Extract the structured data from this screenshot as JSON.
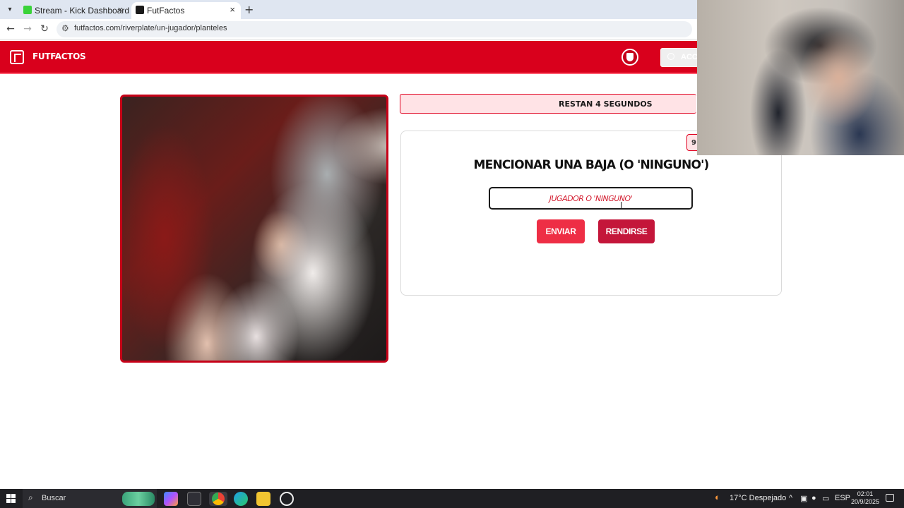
{
  "browser": {
    "tabs": [
      {
        "title": "Stream - Kick Dashboard",
        "close": "×"
      },
      {
        "title": "FutFactos",
        "close": "×"
      }
    ],
    "new_tab": "+",
    "url": "futfactos.com/riverplate/un-jugador/planteles"
  },
  "site": {
    "logo_text": "FUTFACTOS",
    "access_label": "ACCE"
  },
  "game": {
    "timer_text": "RESTAN 4 SEGUNDOS",
    "badge_text": "9",
    "question": "MENCIONAR UNA BAJA (O 'NINGUNO')",
    "input_placeholder": "JUGADOR O 'NINGUNO'",
    "input_value": "",
    "submit_label": "ENVIAR",
    "giveup_label": "RENDIRSE"
  },
  "taskbar": {
    "search_placeholder": "Buscar",
    "weather": "17°C  Despejado",
    "language": "ESP",
    "time": "02:01",
    "date": "20/9/2025"
  },
  "colors": {
    "brand_red": "#d9001c",
    "timer_bg": "#ffe3e6",
    "submit_bg": "#ee2e45",
    "giveup_bg": "#c4163a"
  },
  "icons": [
    "tab-list-icon",
    "kick-favicon-icon",
    "futfactos-favicon-icon",
    "back-icon",
    "forward-icon",
    "reload-icon",
    "site-info-icon",
    "futfactos-logo-icon",
    "club-shield-icon",
    "lock-icon",
    "windows-start-icon",
    "search-icon",
    "weather-icon",
    "notifications-icon"
  ]
}
